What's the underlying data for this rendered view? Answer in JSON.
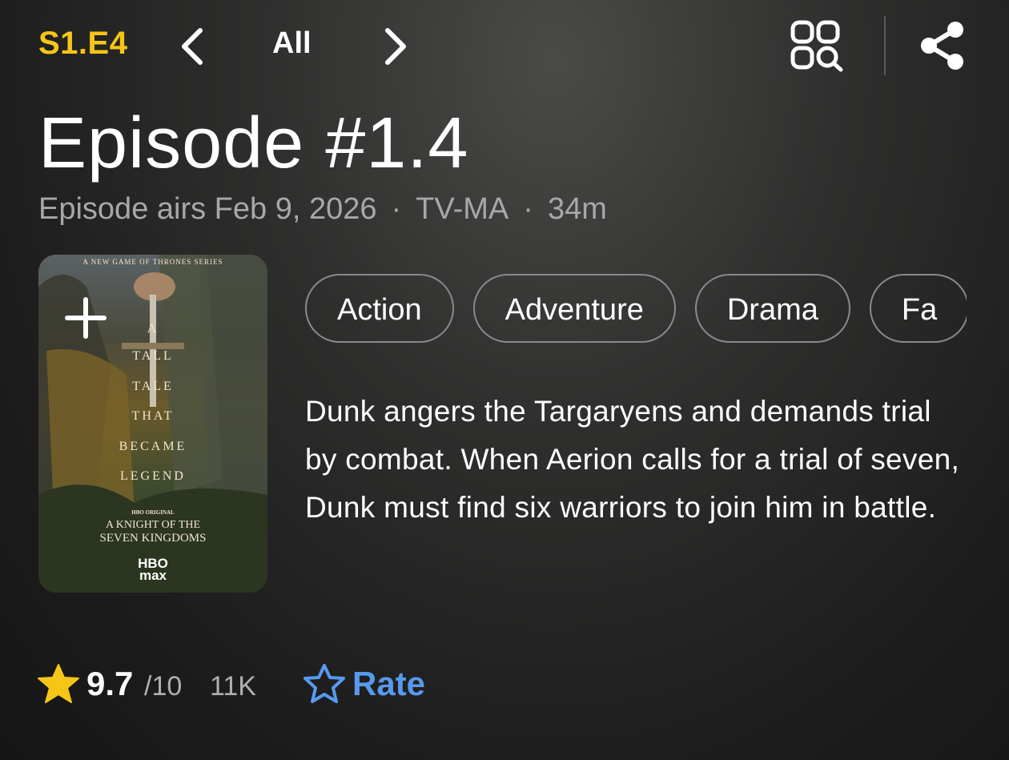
{
  "topbar": {
    "episode_code": "S1.E4",
    "nav_label": "All",
    "colors": {
      "accent": "#f5c518"
    }
  },
  "episode": {
    "title": "Episode #1.4",
    "air_info": "Episode airs Feb 9, 2026",
    "rating_cert": "TV-MA",
    "runtime": "34m",
    "separator": "·"
  },
  "poster": {
    "header": "A NEW GAME OF THRONES SERIES",
    "tagline": [
      "A",
      "TALL",
      "TALE",
      "THAT",
      "BECAME",
      "LEGEND"
    ],
    "original": "HBO ORIGINAL",
    "series_title_1": "A KNIGHT OF THE",
    "series_title_2": "SEVEN KINGDOMS",
    "network_1": "HBO",
    "network_2": "max"
  },
  "genres": [
    "Action",
    "Adventure",
    "Drama",
    "Fa"
  ],
  "description": "Dunk angers the Targaryens and demands trial by combat. When Aerion calls for a trial of seven, Dunk must find six warriors to join him in battle.",
  "rating": {
    "score": "9.7",
    "scale": "/10",
    "votes": "11K",
    "rate_label": "Rate",
    "star_color": "#f5c518",
    "rate_color": "#5799ef"
  }
}
